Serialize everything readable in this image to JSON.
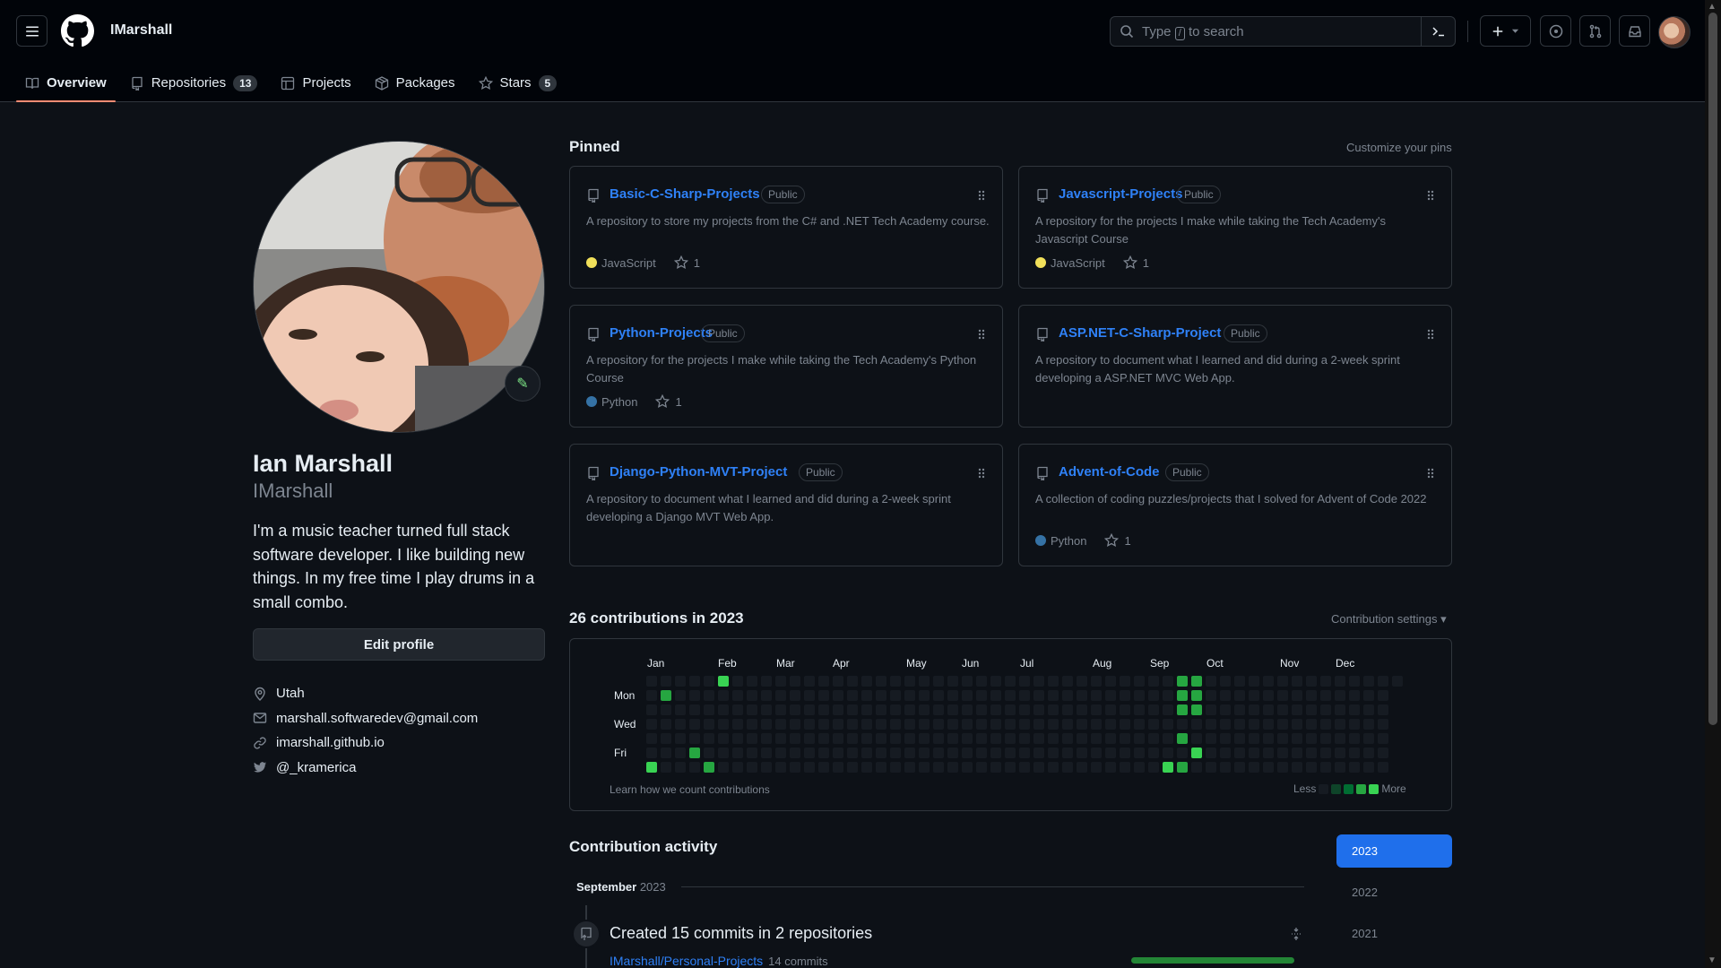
{
  "header": {
    "username": "IMarshall",
    "search_prefix": "Type",
    "search_key": "/",
    "search_suffix": "to search"
  },
  "tabs": [
    {
      "label": "Overview",
      "icon": "book-icon"
    },
    {
      "label": "Repositories",
      "icon": "repo-icon",
      "count": "13"
    },
    {
      "label": "Projects",
      "icon": "table-icon"
    },
    {
      "label": "Packages",
      "icon": "package-icon"
    },
    {
      "label": "Stars",
      "icon": "star-icon",
      "count": "5"
    }
  ],
  "profile": {
    "full_name": "Ian Marshall",
    "login": "IMarshall",
    "bio": "I'm a music teacher turned full stack software developer. I like building new things. In my free time I play drums in a small combo.",
    "edit_label": "Edit profile",
    "location": "Utah",
    "email": "marshall.softwaredev@gmail.com",
    "website": "imarshall.github.io",
    "twitter": "@_kramerica"
  },
  "pinned": {
    "title": "Pinned",
    "customize": "Customize your pins",
    "repos": [
      {
        "name": "Basic-C-Sharp-Projects",
        "visibility": "Public",
        "description": "A repository to store my projects from the C# and .NET Tech Academy course.",
        "language": "JavaScript",
        "language_color": "#f1e05a",
        "stars": "1"
      },
      {
        "name": "Javascript-Projects",
        "visibility": "Public",
        "description": "A repository for the projects I make while taking the Tech Academy's Javascript Course",
        "language": "JavaScript",
        "language_color": "#f1e05a",
        "stars": "1"
      },
      {
        "name": "Python-Projects",
        "visibility": "Public",
        "description": "A repository for the projects I make while taking the Tech Academy's Python Course",
        "language": "Python",
        "language_color": "#3572A5",
        "stars": "1"
      },
      {
        "name": "ASP.NET-C-Sharp-Project",
        "visibility": "Public",
        "description": "A repository to document what I learned and did during a 2-week sprint developing a ASP.NET MVC Web App.",
        "language": "",
        "language_color": "",
        "stars": ""
      },
      {
        "name": "Django-Python-MVT-Project",
        "visibility": "Public",
        "description": "A repository to document what I learned and did during a 2-week sprint developing a Django MVT Web App.",
        "language": "",
        "language_color": "",
        "stars": ""
      },
      {
        "name": "Advent-of-Code",
        "visibility": "Public",
        "description": "A collection of coding puzzles/projects that I solved for Advent of Code 2022",
        "language": "Python",
        "language_color": "#3572A5",
        "stars": "1"
      }
    ]
  },
  "contributions": {
    "title": "26 contributions in 2023",
    "settings": "Contribution settings",
    "months": [
      "Jan",
      "Feb",
      "Mar",
      "Apr",
      "May",
      "Jun",
      "Jul",
      "Aug",
      "Sep",
      "Oct",
      "Nov",
      "Dec"
    ],
    "days": [
      "Mon",
      "Wed",
      "Fri"
    ],
    "learn": "Learn how we count contributions",
    "less": "Less",
    "more": "More",
    "colors": [
      "#161b22",
      "#0e4429",
      "#006d32",
      "#26a641",
      "#39d353"
    ],
    "active_days": [
      {
        "week": 0,
        "day": 6,
        "level": 4
      },
      {
        "week": 1,
        "day": 1,
        "level": 3
      },
      {
        "week": 3,
        "day": 5,
        "level": 3
      },
      {
        "week": 4,
        "day": 6,
        "level": 3
      },
      {
        "week": 5,
        "day": 0,
        "level": 4
      },
      {
        "week": 36,
        "day": 6,
        "level": 4
      },
      {
        "week": 37,
        "day": 0,
        "level": 3
      },
      {
        "week": 37,
        "day": 1,
        "level": 3
      },
      {
        "week": 37,
        "day": 2,
        "level": 3
      },
      {
        "week": 37,
        "day": 4,
        "level": 3
      },
      {
        "week": 37,
        "day": 6,
        "level": 3
      },
      {
        "week": 38,
        "day": 0,
        "level": 3
      },
      {
        "week": 38,
        "day": 1,
        "level": 3
      },
      {
        "week": 38,
        "day": 2,
        "level": 3
      },
      {
        "week": 38,
        "day": 5,
        "level": 4
      }
    ]
  },
  "activity": {
    "title": "Contribution activity",
    "years": [
      "2023",
      "2022",
      "2021"
    ],
    "selected_year": "2023",
    "month": "September",
    "month_year": "2023",
    "event_title": "Created 15 commits in 2 repositories",
    "repo": "IMarshall/Personal-Projects",
    "repo_commits": "14 commits",
    "repo_commit_share": 0.93
  }
}
